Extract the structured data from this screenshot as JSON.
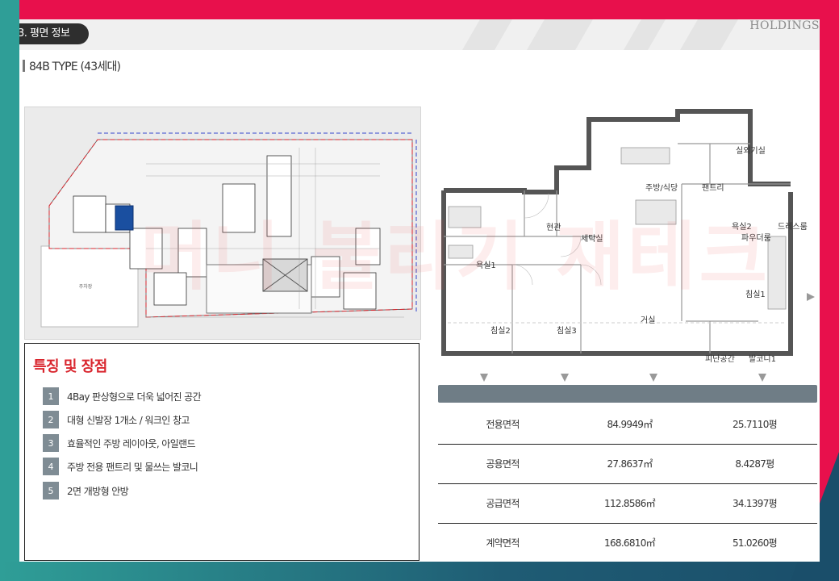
{
  "brand": "HOLDINGS",
  "section": {
    "title": "3. 평면 정보"
  },
  "unit_type": "84B TYPE (43세대)",
  "features": {
    "title": "특징 및 장점",
    "items": [
      {
        "num": "1",
        "text": "4Bay 판상형으로 더욱 넓어진 공간"
      },
      {
        "num": "2",
        "text": "대형 신발장 1개소 / 워크인 창고"
      },
      {
        "num": "3",
        "text": "효율적인 주방 레이아웃, 아일랜드"
      },
      {
        "num": "4",
        "text": "주방 전용 팬트리 및 물쓰는 발코니"
      },
      {
        "num": "5",
        "text": "2면 개방형 안방"
      }
    ]
  },
  "floorplan": {
    "rooms": {
      "outdoor": "실외기실",
      "kitchen": "주방/식당",
      "pantry": "팬트리",
      "entrance": "현관",
      "laundry": "세탁실",
      "bath2": "욕실2",
      "dress": "드레스룸",
      "powder": "파우더룸",
      "bath1": "욕실1",
      "master": "침실1",
      "bed2": "침실2",
      "bed3": "침실3",
      "living": "거실",
      "refuge": "피난공간",
      "balcony": "발코니1"
    }
  },
  "siteplan": {
    "label": "주차장"
  },
  "watermark": "머니 불리기 재테크",
  "area_table": {
    "rows": [
      {
        "label": "전용면적",
        "sqm": "84.9949㎡",
        "pyeong": "25.7110평"
      },
      {
        "label": "공용면적",
        "sqm": "27.8637㎡",
        "pyeong": "8.4287평"
      },
      {
        "label": "공급면적",
        "sqm": "112.8586㎡",
        "pyeong": "34.1397평"
      },
      {
        "label": "계약면적",
        "sqm": "168.6810㎡",
        "pyeong": "51.0260평"
      }
    ]
  },
  "colors": {
    "frame_red": "#e8104c",
    "frame_teal": "#2f9e97",
    "accent_red": "#d9262e",
    "table_header": "#6f7d86"
  }
}
